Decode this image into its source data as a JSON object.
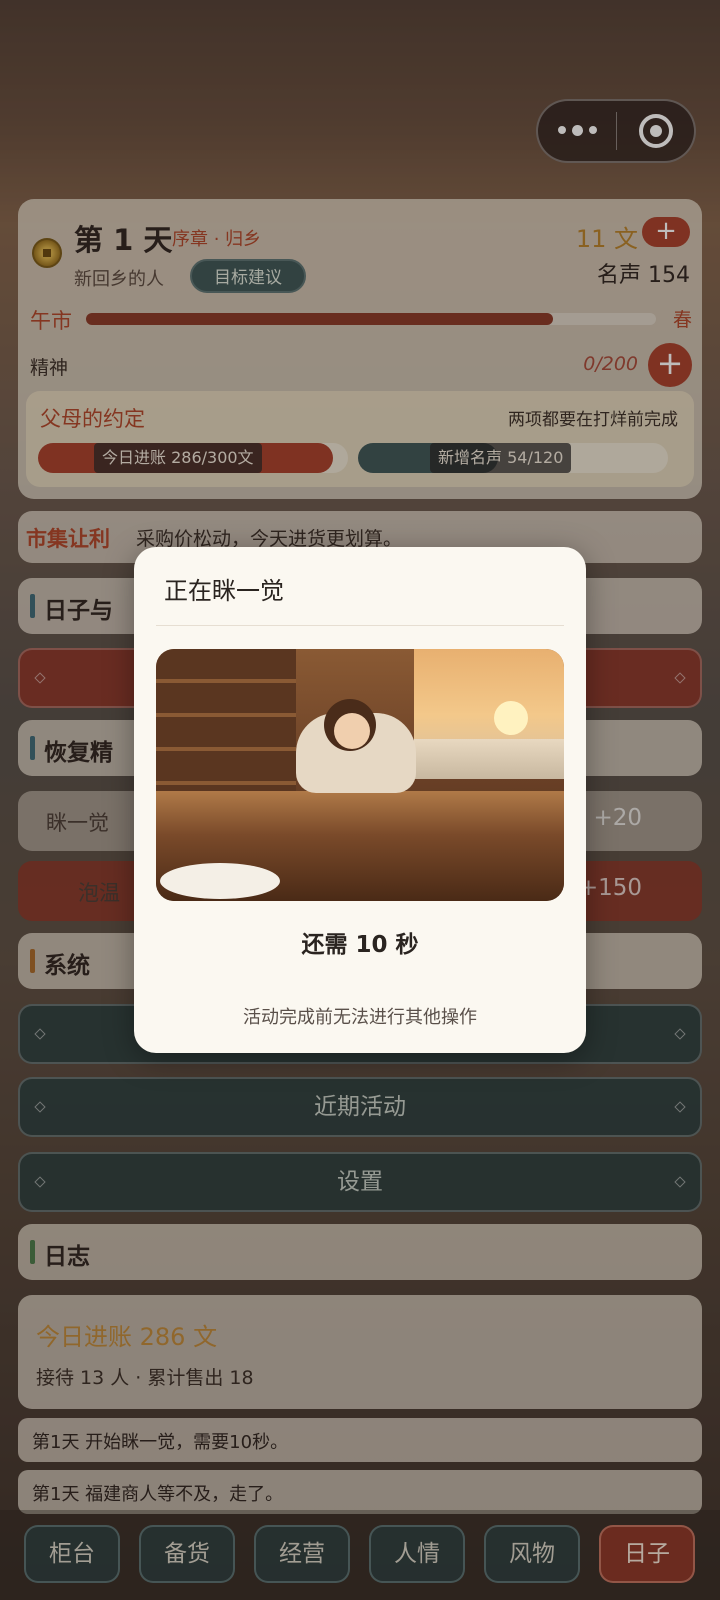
{
  "header": {
    "day_title": "第 1 天",
    "chapter": "序章 · 归乡",
    "role": "新回乡的人",
    "goal_button": "目标建议",
    "money": "11 文",
    "money_add": "+",
    "fame": "名声 154",
    "period": "午市",
    "period_progress": 0.82,
    "season": "春",
    "spirit_label": "精神",
    "spirit_value": "0/200",
    "spirit_add": "+"
  },
  "promise": {
    "title": "父母的约定",
    "note": "两项都要在打烊前完成",
    "income_label": "今日进账 286/300文",
    "income_progress": 0.953,
    "fame_label": "新增名声 54/120",
    "fame_progress": 0.45
  },
  "market": {
    "tag": "市集让利",
    "text": "采购价松动，今天进货更划算。"
  },
  "sections": {
    "days": "日子与",
    "recover": "恢复精",
    "system": "系统",
    "log": "日志"
  },
  "recover_options": [
    {
      "name": "眯一觉",
      "value": "+20"
    },
    {
      "name": "泡温",
      "value": "+150"
    }
  ],
  "buttons": {
    "recent": "近期活动",
    "settings": "设置"
  },
  "summary": {
    "income": "今日进账 286 文",
    "detail": "接待 13 人 · 累计售出 18"
  },
  "logs": [
    "第1天  开始眯一觉，需要10秒。",
    "第1天  福建商人等不及，走了。"
  ],
  "tabs": [
    {
      "label": "柜台",
      "active": false
    },
    {
      "label": "备货",
      "active": false
    },
    {
      "label": "经营",
      "active": false
    },
    {
      "label": "人情",
      "active": false
    },
    {
      "label": "风物",
      "active": false
    },
    {
      "label": "日子",
      "active": true
    }
  ],
  "modal": {
    "title": "正在眯一觉",
    "countdown": "还需 10 秒",
    "note": "活动完成前无法进行其他操作"
  },
  "colors": {
    "accent_red": "#a8402c",
    "teal": "#3d5656",
    "gold": "#b8822a"
  }
}
